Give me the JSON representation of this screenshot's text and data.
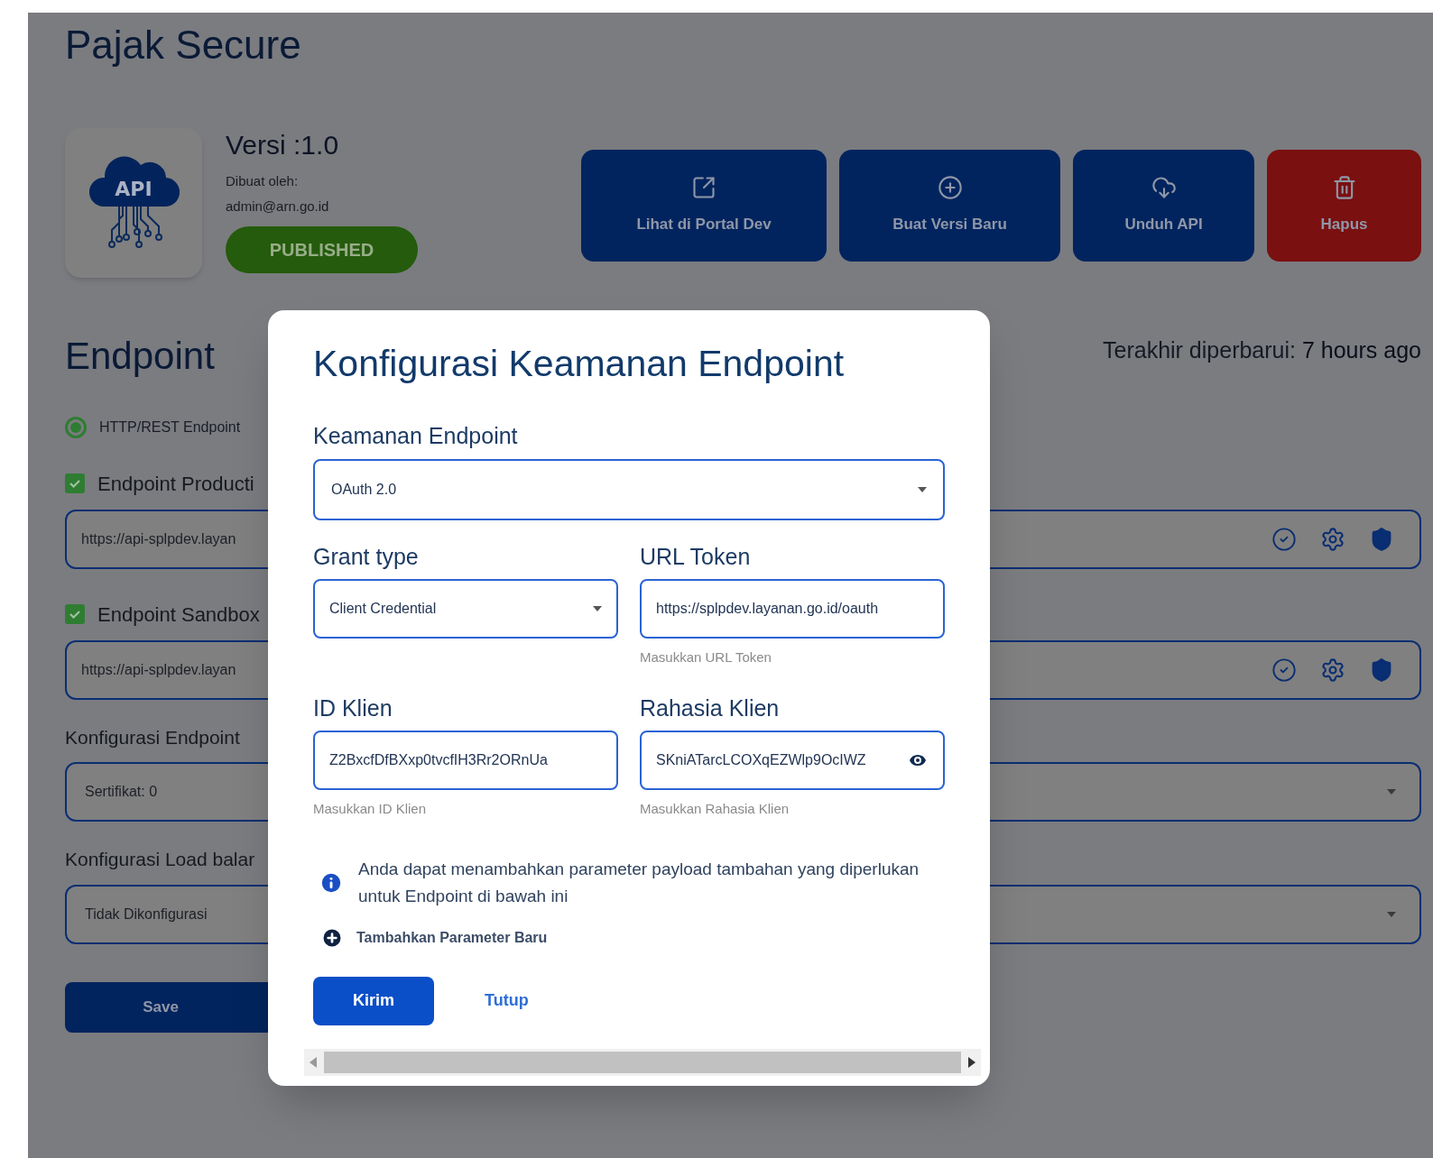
{
  "page": {
    "title": "Pajak Secure",
    "logo_text": "API",
    "version": "Versi :1.0",
    "created_by_label": "Dibuat oleh:",
    "created_by": "admin@arn.go.id",
    "status": "PUBLISHED"
  },
  "actions": [
    {
      "kind": "external",
      "label": "Lihat di Portal Dev"
    },
    {
      "kind": "add",
      "label": "Buat Versi Baru"
    },
    {
      "kind": "download",
      "label": "Unduh API"
    },
    {
      "kind": "delete",
      "label": "Hapus"
    }
  ],
  "endpoint": {
    "heading": "Endpoint",
    "last_updated_label": "Terakhir diperbarui:",
    "last_updated": "7 hours ago",
    "types": [
      {
        "label": "HTTP/REST Endpoint",
        "selected": true
      }
    ],
    "urls": [
      {
        "label": "Endpoint Producti",
        "checked": true,
        "value": "https://api-splpdev.layan"
      },
      {
        "label": "Endpoint Sandbox",
        "checked": true,
        "value": "https://api-splpdev.layan"
      }
    ],
    "selects": [
      {
        "label": "Konfigurasi Endpoint",
        "value": "Sertifikat: 0"
      },
      {
        "label": "Konfigurasi Load balar",
        "value": "Tidak Dikonfigurasi"
      }
    ],
    "save": "Save"
  },
  "dialog": {
    "title": "Konfigurasi Keamanan Endpoint",
    "security": {
      "label": "Keamanan Endpoint",
      "value": "OAuth 2.0"
    },
    "fields": [
      {
        "kind": "select",
        "label": "Grant type",
        "value": "Client Credential"
      },
      {
        "kind": "text",
        "label": "URL Token",
        "value": "https://splpdev.layanan.go.id/oauth",
        "helper": "Masukkan URL Token"
      },
      {
        "kind": "text",
        "label": "ID Klien",
        "value": "Z2BxcfDfBXxp0tvcfIH3Rr2ORnUa",
        "helper": "Masukkan ID Klien"
      },
      {
        "kind": "secret",
        "label": "Rahasia Klien",
        "value": "SKniATarcLCOXqEZWlp9OcIWZ",
        "helper": "Masukkan Rahasia Klien"
      }
    ],
    "info": "Anda dapat menambahkan parameter payload tambahan yang diperlukan untuk Endpoint di bawah ini",
    "add_parameter": "Tambahkan Parameter Baru",
    "buttons": [
      {
        "kind": "primary",
        "label": "Kirim"
      },
      {
        "kind": "text",
        "label": "Tutup"
      }
    ]
  }
}
